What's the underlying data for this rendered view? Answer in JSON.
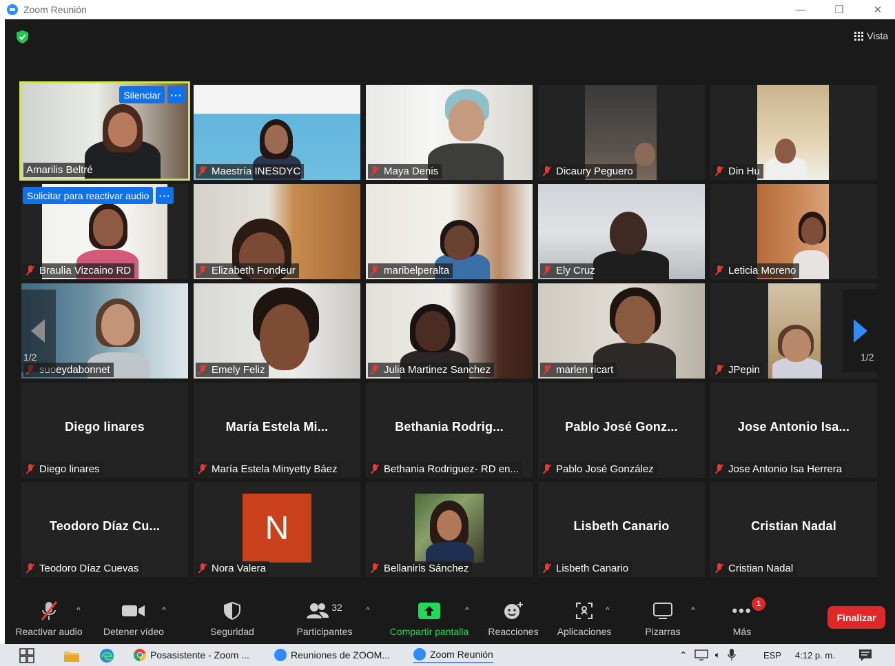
{
  "window": {
    "title": "Zoom Reunión",
    "controls": [
      "—",
      "❐",
      "✕"
    ]
  },
  "top_bar": {
    "view_label": "Vista"
  },
  "speaker_hover": {
    "mute_label": "Silenciar",
    "more_label": "···"
  },
  "ask_unmute": {
    "label": "Solicitar para reactivar audio",
    "more_label": "···"
  },
  "pagination": {
    "left": "1/2",
    "right": "1/2"
  },
  "participants": [
    {
      "name": "Amarilis Beltré",
      "muted": false
    },
    {
      "name": "Maestría INESDYC",
      "muted": true
    },
    {
      "name": "Maya Denis",
      "muted": true
    },
    {
      "name": "Dicaury Peguero",
      "muted": true
    },
    {
      "name": "Din Hu",
      "muted": true
    },
    {
      "name": "Braulia Vizcaino RD",
      "muted": true
    },
    {
      "name": "Elizabeth Fondeur",
      "muted": true
    },
    {
      "name": "maribelperalta",
      "muted": true
    },
    {
      "name": "Ely Cruz",
      "muted": true
    },
    {
      "name": "Leticia Moreno",
      "muted": true
    },
    {
      "name": "suoeydabonnet",
      "muted": true
    },
    {
      "name": "Emely Feliz",
      "muted": true
    },
    {
      "name": "Julia Martinez Sanchez",
      "muted": true
    },
    {
      "name": "marlen ricart",
      "muted": true
    },
    {
      "name": "JPepin",
      "muted": true
    },
    {
      "name": "Diego linares",
      "display": "Diego linares",
      "muted": true
    },
    {
      "name": "María Estela Minyetty Báez",
      "display": "María Estela Mi...",
      "muted": true
    },
    {
      "name": "Bethania Rodriguez- RD en...",
      "display": "Bethania Rodrig...",
      "muted": true
    },
    {
      "name": "Pablo José González",
      "display": "Pablo José Gonz...",
      "muted": true
    },
    {
      "name": "Jose Antonio Isa Herrera",
      "display": "Jose Antonio Isa...",
      "muted": true
    },
    {
      "name": "Teodoro Díaz Cuevas",
      "display": "Teodoro Díaz Cu...",
      "muted": true
    },
    {
      "name": "Nora Valera",
      "initial": "N",
      "muted": true
    },
    {
      "name": "Bellaniris Sánchez",
      "muted": true
    },
    {
      "name": "Lisbeth Canario",
      "display": "Lisbeth Canario",
      "muted": true
    },
    {
      "name": "Cristian Nadal",
      "display": "Cristian Nadal",
      "muted": true
    }
  ],
  "toolbar": {
    "unmute": "Reactivar audio",
    "stop_video": "Detener vídeo",
    "security": "Seguridad",
    "participants": "Participantes",
    "participant_count": "32",
    "share": "Compartir pantalla",
    "reactions": "Reacciones",
    "apps": "Aplicaciones",
    "whiteboards": "Pizarras",
    "more": "Más",
    "more_badge": "1",
    "end": "Finalizar",
    "caret": "^"
  },
  "taskbar": {
    "items": [
      "Posasistente - Zoom ...",
      "Reuniones de ZOOM...",
      "Zoom Reunión"
    ],
    "lang": "ESP",
    "time": "4:12 p. m."
  },
  "colors": {
    "speaking_outline": "#cfe35a",
    "zoom_blue": "#0e72ed",
    "end_red": "#e02828",
    "share_green": "#23d959"
  }
}
